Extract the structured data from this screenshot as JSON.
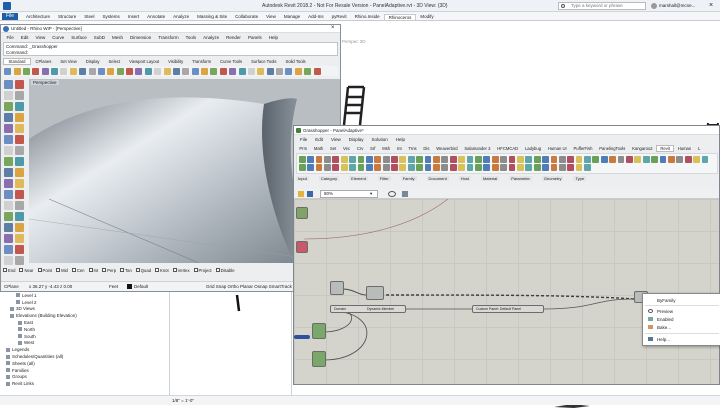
{
  "revit": {
    "title": "Autodesk Revit 2018.2 - Not For Resale Version - PanelAdaptive.rvt - 3D View: {3D}",
    "file_button": "File",
    "tabs": [
      "Architecture",
      "Structure",
      "Steel",
      "Systems",
      "Insert",
      "Annotate",
      "Analyze",
      "Massing & Site",
      "Collaborate",
      "View",
      "Manage",
      "Add-Ins",
      "pyRevit",
      "Rhino.Inside",
      "Rhinoceros",
      "Modify"
    ],
    "active_tab": "Rhinoceros",
    "search_placeholder": "Type a keyword or phrase",
    "user": "marshall@mcne...",
    "view_label": "Perspec 3D",
    "browser_items": [
      "Level 1",
      "Level 2",
      "3D Views",
      "Elevations (Building Elevation)",
      "East",
      "North",
      "South",
      "West",
      "Legends",
      "Schedules/Quantities (all)",
      "Sheets (all)",
      "Families",
      "Groups",
      "Revit Links"
    ],
    "status_scale": "1/8\" = 1'-0\""
  },
  "rhino": {
    "title": "Untitled - Rhino WIP - [Perspective]",
    "menu": [
      "File",
      "Edit",
      "View",
      "Curve",
      "Surface",
      "SubD",
      "Mesh",
      "Dimension",
      "Transform",
      "Tools",
      "Analyze",
      "Render",
      "Panels",
      "Help"
    ],
    "command_history": "Command: _Grasshopper",
    "command_prompt": "Command:",
    "toolbar_tabs": [
      "Standard",
      "CPlanes",
      "Set View",
      "Display",
      "Select",
      "Viewport Layout",
      "Visibility",
      "Transform",
      "Curve Tools",
      "Surface Tools",
      "Solid Tools"
    ],
    "viewport_label": "Perspective",
    "osnaps": [
      "End",
      "Near",
      "Point",
      "Mid",
      "Cen",
      "Int",
      "Perp",
      "Tan",
      "Quad",
      "Knot",
      "Vertex",
      "Project",
      "Disable"
    ],
    "status_cplane": "CPlane",
    "status_coords": "x 36.27  y -4.43  z 0.00",
    "status_units": "Feet",
    "status_layer": "Default",
    "status_modes": "Grid Snap  Ortho  Planar  Osnap  SmartTrack  Gumball  R"
  },
  "grasshopper": {
    "title": "Grasshopper - PanelAdaptive*",
    "menu": [
      "File",
      "Edit",
      "View",
      "Display",
      "Solution",
      "Help"
    ],
    "ribbon_tabs": [
      "Prm",
      "Math",
      "Set",
      "Vec",
      "Crv",
      "Srf",
      "Msh",
      "Int",
      "Trns",
      "Dis",
      "Weaverbird",
      "Salamander 3",
      "HFCMCAD",
      "Ladybug",
      "Human UI",
      "PufferFish",
      "PanelingTools",
      "Kangaroo2",
      "Revit",
      "Human",
      "L"
    ],
    "active_ribbon_tab": "Revit",
    "ribbon_groups": [
      "Input",
      "Category",
      "Element",
      "Filter",
      "Family",
      "Document",
      "Host",
      "Material",
      "Parameter",
      "Geometry",
      "Type"
    ],
    "zoom": "80%",
    "components": [
      "Domain",
      "Dynamic Member",
      "Custom Panel: Default Panel"
    ],
    "context_menu": [
      "ByFamily",
      "Preview",
      "Enabled",
      "Bake...",
      "Help..."
    ]
  }
}
